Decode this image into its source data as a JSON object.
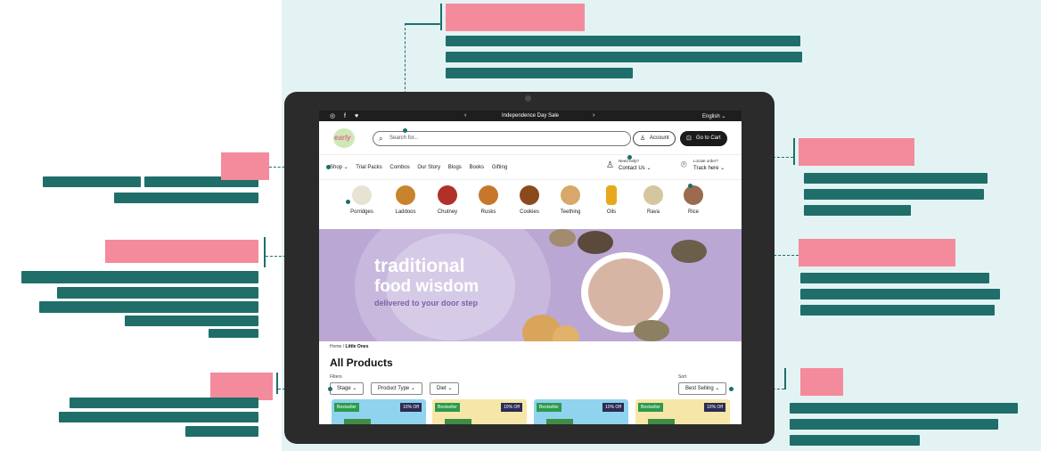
{
  "annotations": {
    "top_tag": "",
    "nav_tag": "",
    "category_tag": "",
    "filter_tag": "",
    "help_tag": "",
    "track_tag": "",
    "sort_tag": ""
  },
  "site": {
    "topbar": {
      "social": "◎ f ♥",
      "prev": "‹",
      "sale": "Independence Day Sale",
      "next": "›",
      "language": "English ⌄"
    },
    "logo_text": "early",
    "search_placeholder": "Search for...",
    "account_label": "Account",
    "cart_label": "Go to Cart",
    "nav_items": [
      "Shop ⌄",
      "Trial Packs",
      "Combos",
      "Our Story",
      "Blogs",
      "Books",
      "Gifting"
    ],
    "help": {
      "small": "Need help?",
      "big": "Contact Us ⌄"
    },
    "track": {
      "small": "Locate order?",
      "big": "Track here ⌄"
    },
    "categories": [
      {
        "label": "Porridges",
        "color": "#e8e2d2"
      },
      {
        "label": "Laddoos",
        "color": "#c9832c"
      },
      {
        "label": "Chutney",
        "color": "#b1302a"
      },
      {
        "label": "Rusks",
        "color": "#c7772c"
      },
      {
        "label": "Cookies",
        "color": "#8b4a1e"
      },
      {
        "label": "Teething",
        "color": "#d9a76a"
      },
      {
        "label": "Oils",
        "color": "#e7a91b"
      },
      {
        "label": "Rava",
        "color": "#d6c6a0"
      },
      {
        "label": "Rice",
        "color": "#9a6b4e"
      }
    ],
    "hero": {
      "line1": "traditional",
      "line2": "food wisdom",
      "line3": "delivered to your door step"
    },
    "breadcrumb": {
      "home": "Home",
      "sep": "/",
      "current": "Little Ones"
    },
    "page_title": "All Products",
    "filters_label": "Filters",
    "filters": [
      "Stage ⌄",
      "Product Type ⌄",
      "Diet ⌄"
    ],
    "sort_label": "Sort",
    "sort_value": "Best Selling ⌄",
    "products": [
      {
        "badge": "Bestseller",
        "discount": "10% Off",
        "color": "#8fd3ee"
      },
      {
        "badge": "Bestseller",
        "discount": "10% Off",
        "color": "#f6e7a8"
      },
      {
        "badge": "Bestseller",
        "discount": "10% Off",
        "color": "#8fd3ee"
      },
      {
        "badge": "Bestseller",
        "discount": "10% Off",
        "color": "#f6e7a8"
      }
    ]
  }
}
